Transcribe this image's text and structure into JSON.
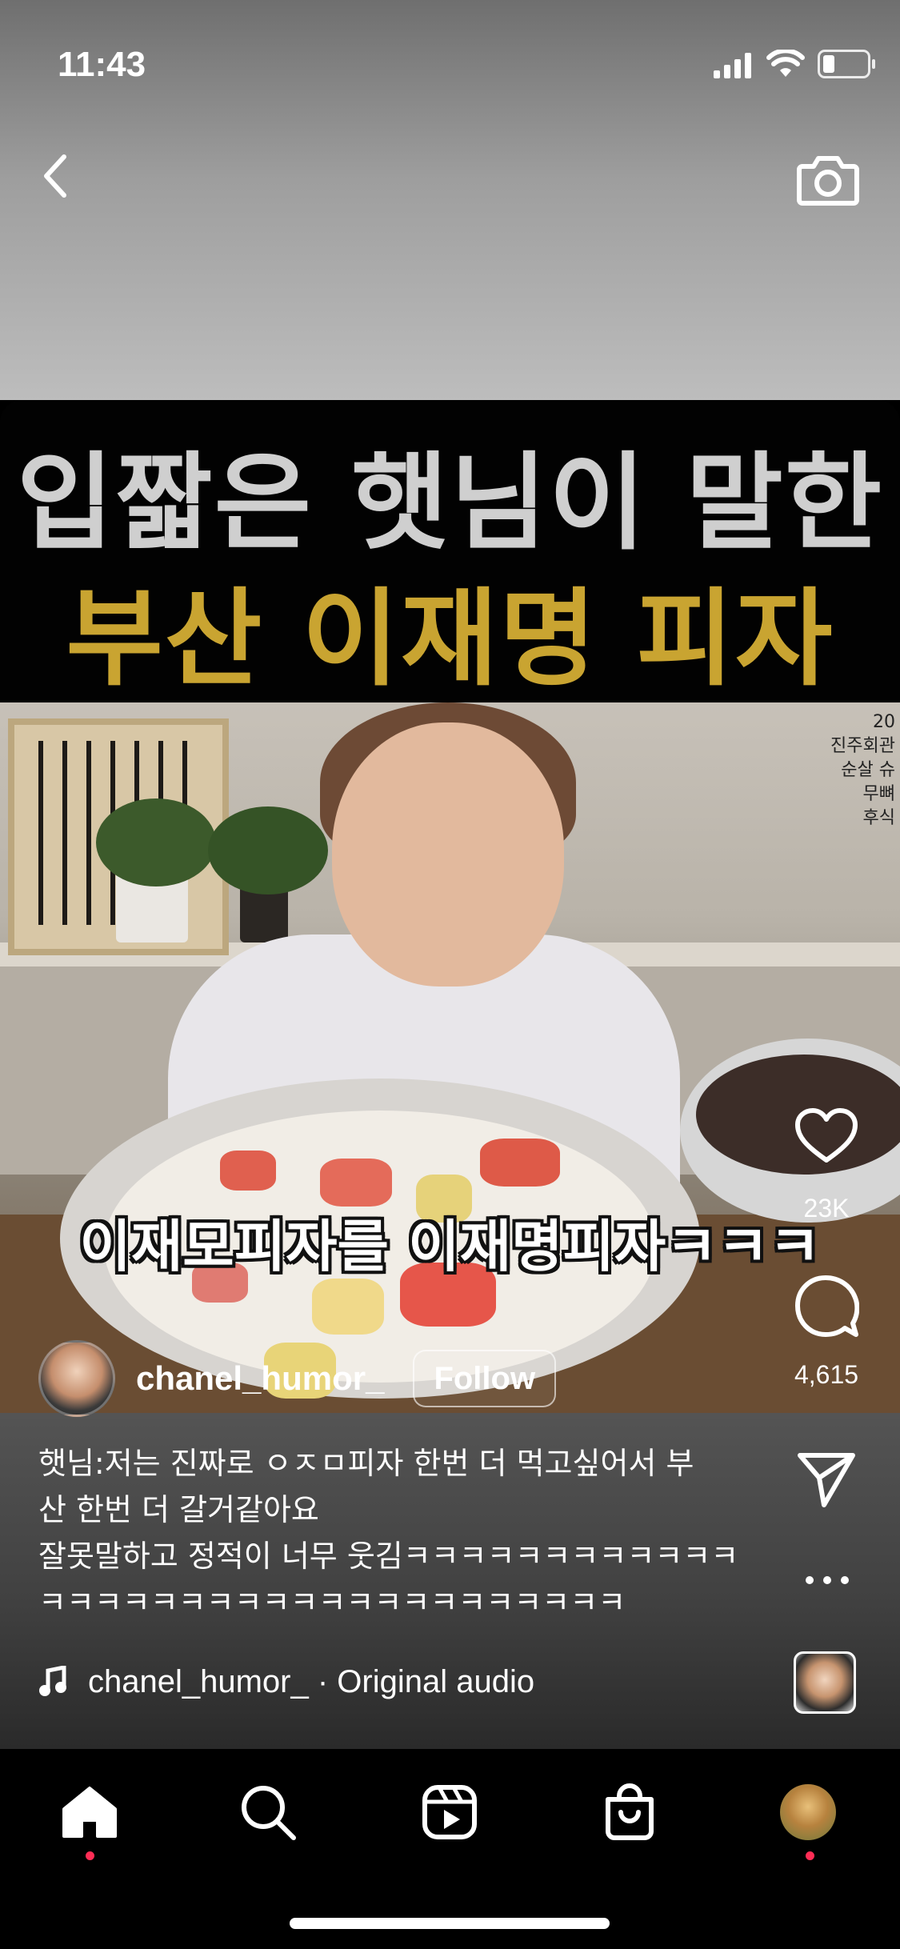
{
  "status_bar": {
    "time": "11:43"
  },
  "video": {
    "headline_line1": "입짧은 햇님이 말한",
    "headline_line2": "부산 이재명 피자",
    "subtitle": "이재모피자를 이재명피자ㅋㅋㅋ",
    "side_text": [
      "20",
      "진주회관",
      "순살 슈",
      "무뼈",
      "후식"
    ],
    "colors": {
      "headline_gray": "#cfcfcf",
      "headline_gold": "#c9a431"
    }
  },
  "actions": {
    "likes": "23K",
    "comments": "4,615"
  },
  "author": {
    "username": "chanel_humor_",
    "follow_label": "Follow"
  },
  "caption": {
    "lines": [
      "햇님:저는 진짜로 ㅇㅈㅁ피자 한번 더 먹고싶어서 부",
      "산 한번 더 갈거같아요",
      "잘못말하고 정적이 너무 웃김ㅋㅋㅋㅋㅋㅋㅋㅋㅋㅋㅋㅋ",
      "ㅋㅋㅋㅋㅋㅋㅋㅋㅋㅋㅋㅋㅋㅋㅋㅋㅋㅋㅋㅋㅋ"
    ]
  },
  "audio": {
    "label": "chanel_humor_ · Original audio"
  },
  "icons": {
    "back": "chevron-left-icon",
    "camera": "camera-icon",
    "like": "heart-icon",
    "comment": "comment-icon",
    "share": "send-icon",
    "more": "more-icon",
    "music": "music-note-icon",
    "tabs": [
      "home-icon",
      "search-icon",
      "reels-icon",
      "shop-icon",
      "profile-avatar"
    ]
  },
  "tab_indicators": {
    "home": true,
    "profile": true,
    "color": "#ff2d55"
  }
}
